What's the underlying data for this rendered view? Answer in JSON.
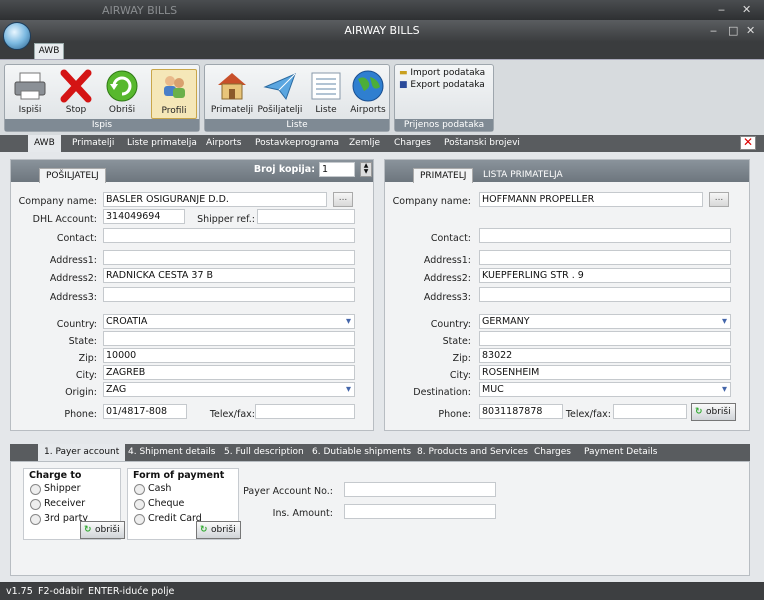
{
  "window": {
    "outer_title": "AIRWAY BILLS",
    "title": "AIRWAY BILLS",
    "min": "‒",
    "close": "✕",
    "inner_min": "‒",
    "inner_max": "□",
    "inner_close": "✕"
  },
  "ribbon": {
    "tab": "AWB",
    "groups": [
      {
        "label": "Ispis",
        "buttons": [
          "Ispiši",
          "Stop",
          "Obriši",
          "Profili"
        ]
      },
      {
        "label": "Liste",
        "buttons": [
          "Primatelji",
          "Pošiljatelji",
          "Liste",
          "Airports"
        ]
      },
      {
        "label": "Prijenos podataka",
        "buttons": [
          "Import podataka",
          "Export podataka"
        ]
      }
    ]
  },
  "tabs": [
    "AWB",
    "Primatelji",
    "Liste primatelja",
    "Airports",
    "Postavkeprograma",
    "Zemlje",
    "Charges",
    "Poštanski brojevi"
  ],
  "sender": {
    "tab": "POŠILJATELJ",
    "copies_label": "Broj kopija:",
    "copies": "1",
    "labels": {
      "company": "Company name:",
      "dhl": "DHL Account:",
      "shipper_ref": "Shipper ref.:",
      "contact": "Contact:",
      "address1": "Address1:",
      "address2": "Address2:",
      "address3": "Address3:",
      "country": "Country:",
      "state": "State:",
      "zip": "Zip:",
      "city": "City:",
      "origin": "Origin:",
      "phone": "Phone:",
      "telex": "Telex/fax:"
    },
    "values": {
      "company": "BASLER OSIGURANJE  D.D.",
      "dhl": "314049694",
      "shipper_ref": "",
      "contact": "",
      "address1": "",
      "address2": "RADNICKA CESTA 37 B",
      "address3": "",
      "country": "CROATIA",
      "state": "",
      "zip": "10000",
      "city": "ZAGREB",
      "origin": "ZAG",
      "phone": "01/4817-808",
      "telex": ""
    },
    "dots": "..."
  },
  "receiver": {
    "tabs": [
      "PRIMATELJ",
      "LISTA PRIMATELJA"
    ],
    "labels": {
      "company": "Company name:",
      "contact": "Contact:",
      "address1": "Address1:",
      "address2": "Address2:",
      "address3": "Address3:",
      "country": "Country:",
      "state": "State:",
      "zip": "Zip:",
      "city": "City:",
      "destination": "Destination:",
      "phone": "Phone:",
      "telex": "Telex/fax:"
    },
    "values": {
      "company": "HOFFMANN  PROPELLER",
      "contact": "",
      "address1": "",
      "address2": "KUEPFERLING  STR . 9",
      "address3": "",
      "country": "GERMANY",
      "state": "",
      "zip": "83022",
      "city": "ROSENHEIM",
      "destination": "MUC",
      "phone": "8031187878",
      "telex": ""
    },
    "dots": "...",
    "obrisi": "obriši"
  },
  "bottom_tabs": [
    "1. Payer account",
    "4. Shipment details",
    "5. Full description",
    "6. Dutiable shipments",
    "8. Products and Services",
    "Charges",
    "Payment Details"
  ],
  "payer": {
    "charge_to": {
      "legend": "Charge to",
      "options": [
        "Shipper",
        "Receiver",
        "3rd party"
      ]
    },
    "form_of_payment": {
      "legend": "Form of payment",
      "options": [
        "Cash",
        "Cheque",
        "Credit Card"
      ]
    },
    "obrisi": "obriši",
    "payer_account_label": "Payer Account No.:",
    "payer_account": "",
    "ins_amount_label": "Ins. Amount:",
    "ins_amount": ""
  },
  "status": {
    "version": "v1.75",
    "f2": "F2-odabir",
    "enter": "ENTER-iduće polje"
  }
}
